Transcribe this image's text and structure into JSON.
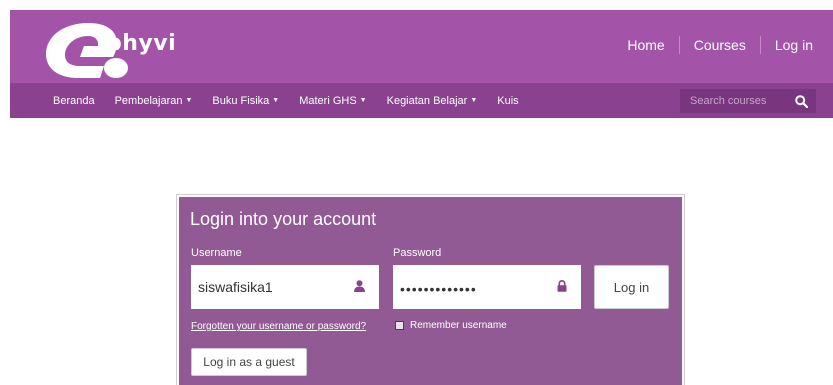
{
  "header": {
    "logo_text": "phyvi",
    "links": [
      {
        "label": "Home"
      },
      {
        "label": "Courses"
      },
      {
        "label": "Log in"
      }
    ]
  },
  "nav": {
    "items": [
      {
        "label": "Beranda",
        "dropdown": false
      },
      {
        "label": "Pembelajaran",
        "dropdown": true
      },
      {
        "label": "Buku Fisika",
        "dropdown": true
      },
      {
        "label": "Materi GHS",
        "dropdown": true
      },
      {
        "label": "Kegiatan Belajar",
        "dropdown": true
      },
      {
        "label": "Kuis",
        "dropdown": false
      }
    ],
    "search_placeholder": "Search courses",
    "search_icon": "search-icon"
  },
  "login": {
    "title": "Login into your account",
    "username_label": "Username",
    "username_value": "siswafisika1",
    "username_icon": "user-icon",
    "password_label": "Password",
    "password_value": "•••••••••••••",
    "password_icon": "lock-icon",
    "login_button": "Log in",
    "forgot_link": "Forgotten your username or password?",
    "remember_label": "Remember username",
    "guest_button": "Log in as a guest"
  },
  "colors": {
    "header_bg": "#a454a8",
    "nav_bg": "#8a4290",
    "panel_bg": "#915a95"
  }
}
